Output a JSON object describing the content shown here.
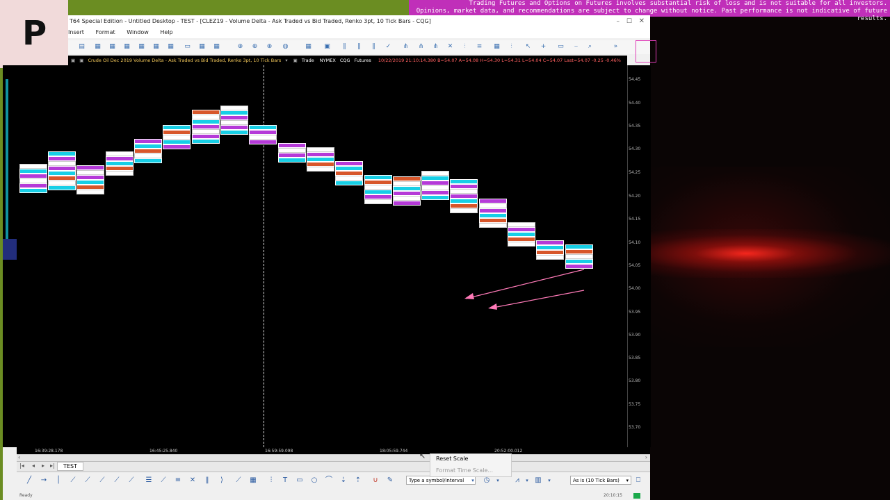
{
  "disclaimer": {
    "line1": "Trading Futures and Options on Futures involves substantial risk of loss and is not suitable for all investors.",
    "line2": "Opinions, market data, and recommendations are subject to change without notice. Past performance is not indicative of future results."
  },
  "logo": {
    "letter": "P"
  },
  "window": {
    "title": "T64 Special Edition - Untitled Desktop - TEST - [CLEZ19 - Volume Delta - Ask Traded vs Bid Traded, Renko 3pt, 10 Tick Bars - CQG]"
  },
  "menu": {
    "insert": "Insert",
    "format": "Format",
    "window": "Window",
    "help": "Help"
  },
  "chart": {
    "header_left": "Crude Oil Dec 2019  Volume Delta - Ask Traded vs Bid Traded, Renko 3pt, 10 Tick Bars",
    "header_trade": "Trade",
    "header_exchange": "NYMEX",
    "header_cqg": "CQG",
    "header_futures": "Futures",
    "header_quote": "10/22/2019  21:10:14.380  B=54.07  A=54.08  H=54.30  L=54.31  L=54.04  C=54.07  Last=54.07  -0.25  -0.46%",
    "price_labels": [
      "54.45",
      "54.40",
      "54.35",
      "54.30",
      "54.25",
      "54.20",
      "54.15",
      "54.10",
      "54.05",
      "54.00",
      "53.95",
      "53.90",
      "53.85",
      "53.80",
      "53.75",
      "53.70"
    ],
    "time_labels": [
      "16:39:28.178",
      "16:45:25.840",
      "16:59:59.098",
      "18:05:59.744",
      "20:52:00.012"
    ]
  },
  "tabs": {
    "tab1": "TEST"
  },
  "context_menu": {
    "item1": "Reset Scale",
    "item2": "Format Time Scale..."
  },
  "symbol_input": {
    "value": "Type a symbol/interval"
  },
  "interval_select": {
    "value": "As is (10 Tick Bars)"
  },
  "status": {
    "left": "Ready",
    "right": "20:10:15"
  },
  "colors": {
    "accent": "#c02fb9",
    "frame": "#6b8d22",
    "cyan": "#17cfe6",
    "magenta": "#b53ad8",
    "arrow": "#ff7ab8"
  }
}
